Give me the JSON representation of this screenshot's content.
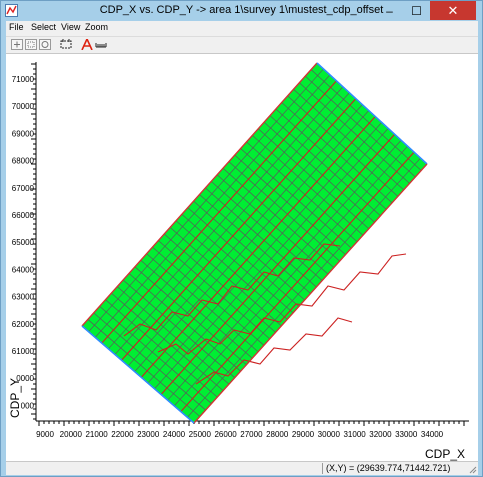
{
  "window": {
    "title": "CDP_X vs. CDP_Y -> area 1\\survey 1\\mustest_cdp_offset",
    "minimize_glyph": "–",
    "maximize_glyph": "☐",
    "close_glyph": "✕"
  },
  "menu": {
    "items": [
      "File",
      "Select",
      "View",
      "Zoom"
    ]
  },
  "toolbar": {
    "icons": [
      "zoom-in-icon",
      "zoom-box-icon",
      "zoom-out-icon",
      "select-icon",
      "annotate-icon",
      "measure-icon"
    ]
  },
  "plot": {
    "x_label": "CDP_X",
    "y_label": "CDP_Y",
    "x_ticks": [
      "9000",
      "20000",
      "21000",
      "22000",
      "23000",
      "24000",
      "25000",
      "26000",
      "27000",
      "28000",
      "29000",
      "30000",
      "31000",
      "32000",
      "33000",
      "34000"
    ],
    "y_ticks": [
      "71000",
      "70000",
      "69000",
      "68000",
      "67000",
      "66000",
      "65000",
      "64000",
      "63000",
      "62000",
      "61000",
      "0000",
      "000"
    ],
    "colors": {
      "fill": "#00ee33",
      "grid_lines": "#5a5a5a",
      "border_left": "#2f8bff",
      "border_right": "#d23434",
      "red_lines": "#cc2222"
    }
  },
  "status": {
    "coords": "(X,Y) = (29639.774,71442.721)"
  }
}
